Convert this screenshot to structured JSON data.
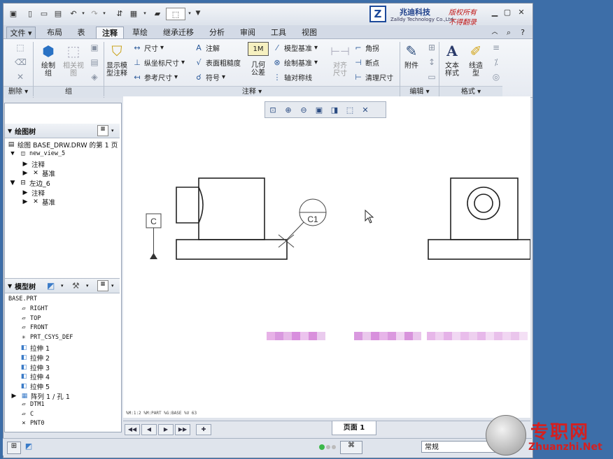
{
  "brand": {
    "logo_letter": "Z",
    "name": "兆迪科技",
    "sub": "Zalldy Technology Co.,Ltd.",
    "red1": "版权所有",
    "red2": "不得翻录"
  },
  "tabs": [
    "文件",
    "布局",
    "表",
    "注释",
    "草绘",
    "继承迁移",
    "分析",
    "审阅",
    "工具",
    "视图"
  ],
  "active_tab": "注释",
  "ribbon": {
    "delete_group": "删除",
    "group_group": "组",
    "annotate_group": "注释",
    "edit_group": "编辑",
    "format_group": "格式",
    "draw_group_btn": [
      "绘制",
      "组"
    ],
    "related_view_btn": [
      "相关视",
      "图"
    ],
    "show_model_btn": [
      "显示模",
      "型注释"
    ],
    "dimension": "尺寸",
    "ordinate_dim": "纵坐标尺寸",
    "ref_dim": "参考尺寸",
    "note": "注解",
    "surface_finish": "表面粗糙度",
    "symbol": "符号",
    "geom_tol": [
      "几何",
      "公差"
    ],
    "model_datum": "模型基准",
    "draw_datum": "绘制基准",
    "axis_symmetry": "轴对称线",
    "align_dim": [
      "对齐",
      "尺寸"
    ],
    "jog": "角拐",
    "breakpoint": "断点",
    "cleanup_dim": "清理尺寸",
    "attachment": "附件",
    "text_style": [
      "文本",
      "样式"
    ],
    "line_style": [
      "线造",
      "型"
    ],
    "geom_tol_icon_text": "1M"
  },
  "drawing_tree": {
    "title": "绘图树",
    "items": [
      "绘图 BASE_DRW.DRW 的第 1 页",
      "new_view_5",
      "注释",
      "基准",
      "左边_6",
      "注释",
      "基准"
    ]
  },
  "model_tree": {
    "title": "模型树",
    "items": [
      "BASE.PRT",
      "RIGHT",
      "TOP",
      "FRONT",
      "PRT_CSYS_DEF",
      "拉伸 1",
      "拉伸 2",
      "拉伸 3",
      "拉伸 4",
      "拉伸 5",
      "阵列 1 / 孔 1",
      "DTM1",
      "C",
      "PNT0"
    ]
  },
  "drawing": {
    "datum_label": "C",
    "tol_label": "C1"
  },
  "status_line": "%M:1:2      %M:PART  %G:BASE  %V 63",
  "page_label": "页面 1",
  "bottom_combo": "常规",
  "watermark": {
    "text": "专职网",
    "url": "Zhuanzhi.Net"
  }
}
